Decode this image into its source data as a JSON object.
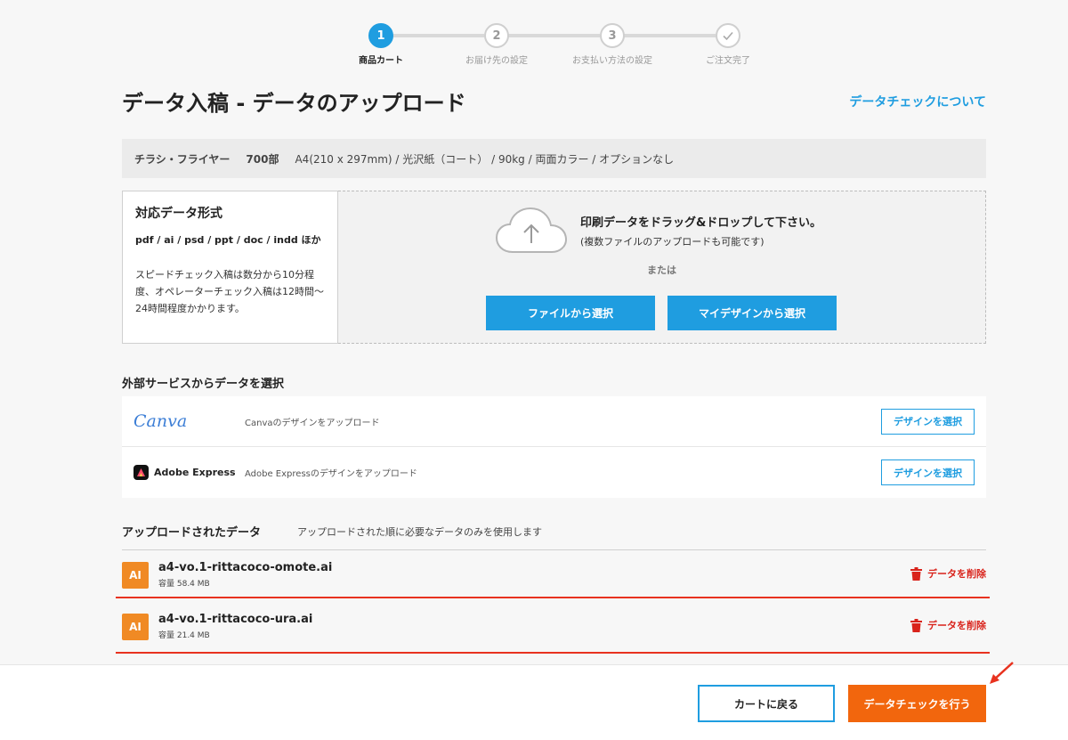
{
  "stepper": {
    "steps": [
      {
        "number": "1",
        "label": "商品カート"
      },
      {
        "number": "2",
        "label": "お届け先の設定"
      },
      {
        "number": "3",
        "label": "お支払い方法の設定"
      },
      {
        "number": "",
        "label": "ご注文完了"
      }
    ],
    "active_step": 1
  },
  "header": {
    "title": "データ入稿 - データのアップロード",
    "data_check_link": "データチェックについて"
  },
  "product": {
    "name": "チラシ・フライヤー",
    "quantity": "700部",
    "spec": "A4(210 x 297mm) / 光沢紙（コート） / 90kg / 両面カラー / オプションなし"
  },
  "formats": {
    "title": "対応データ形式",
    "list": "pdf / ai / psd / ppt / doc / indd ほか",
    "description": "スピードチェック入稿は数分から10分程度、オペレーターチェック入稿は12時間〜24時間程度かかります。"
  },
  "dropzone": {
    "main_text": "印刷データをドラッグ&ドロップして下さい。",
    "sub_text": "(複数ファイルのアップロードも可能です)",
    "or_text": "または",
    "file_button": "ファイルから選択",
    "mydesign_button": "マイデザインから選択"
  },
  "external": {
    "title": "外部サービスからデータを選択",
    "services": [
      {
        "logo": "Canva",
        "description": "Canvaのデザインをアップロード",
        "button": "デザインを選択"
      },
      {
        "logo": "Adobe Express",
        "description": "Adobe Expressのデザインをアップロード",
        "button": "デザインを選択"
      }
    ]
  },
  "uploaded": {
    "title": "アップロードされたデータ",
    "note": "アップロードされた順に必要なデータのみを使用します",
    "files": [
      {
        "badge": "AI",
        "name": "a4-vo.1-rittacoco-omote.ai",
        "size": "容量 58.4 MB",
        "delete": "データを削除"
      },
      {
        "badge": "AI",
        "name": "a4-vo.1-rittacoco-ura.ai",
        "size": "容量 21.4 MB",
        "delete": "データを削除"
      }
    ]
  },
  "footer": {
    "back_button": "カートに戻る",
    "check_button": "データチェックを行う"
  },
  "colors": {
    "accent_blue": "#1f9de0",
    "orange": "#f2660d",
    "badge_orange": "#f08a24",
    "delete_red": "#d9231b",
    "highlight_red": "#e8321f"
  }
}
